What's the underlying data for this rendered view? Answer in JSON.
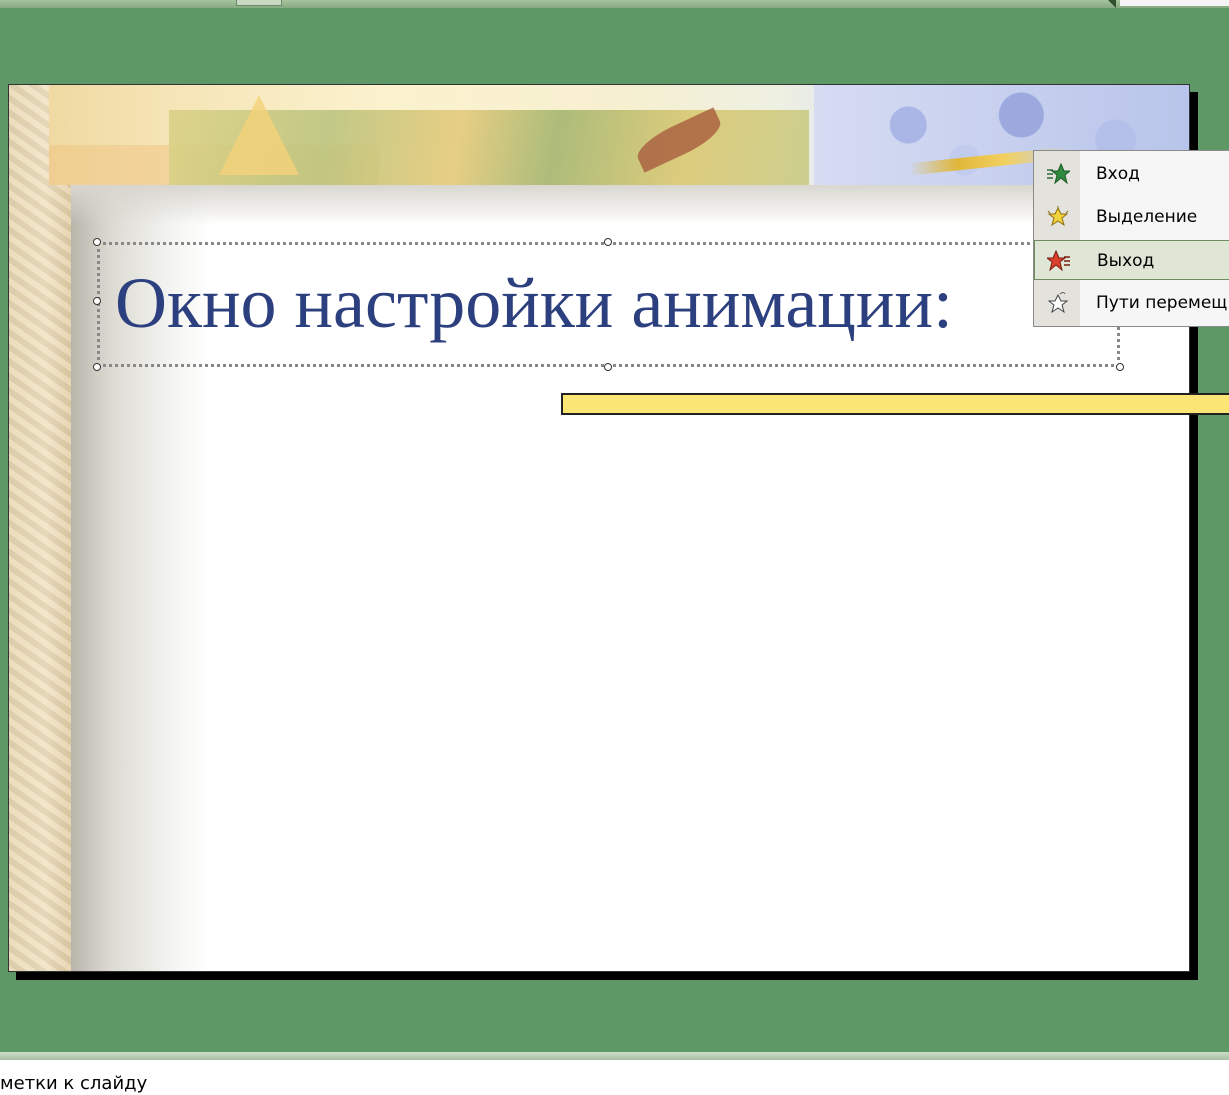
{
  "slide": {
    "title": "Окно настройки анимации:"
  },
  "animation_menu": {
    "items": [
      {
        "label": "Вход",
        "icon": "entrance-star-icon",
        "color": "#2e8a3e",
        "selected": false
      },
      {
        "label": "Выделение",
        "icon": "emphasis-star-icon",
        "color": "#f2d23a",
        "selected": false
      },
      {
        "label": "Выход",
        "icon": "exit-star-icon",
        "color": "#d9402b",
        "selected": true
      },
      {
        "label": "Пути перемещ",
        "icon": "motion-path-star-icon",
        "color": "#ffffff",
        "selected": false
      }
    ]
  },
  "notes_pane": {
    "text": "метки к слайду"
  },
  "colors": {
    "workspace": "#5e9866",
    "title_text": "#2c3f7e",
    "callout_bar": "#fbe675"
  }
}
